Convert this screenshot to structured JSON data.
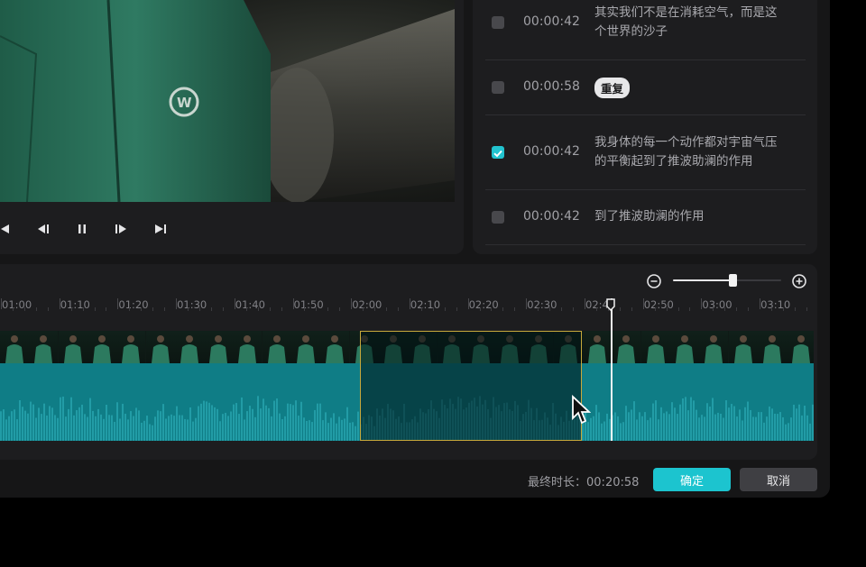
{
  "player": {
    "controls": [
      {
        "name": "skip-back-icon"
      },
      {
        "name": "step-back-icon"
      },
      {
        "name": "pause-icon"
      },
      {
        "name": "step-forward-icon"
      },
      {
        "name": "skip-forward-icon"
      }
    ]
  },
  "transcript": {
    "rows": [
      {
        "checked": false,
        "time": "00:00:42",
        "text": "其实我们不是在消耗空气，而是这个世界的沙子"
      },
      {
        "checked": false,
        "time": "00:00:58",
        "badge": "重复"
      },
      {
        "checked": true,
        "time": "00:00:42",
        "text": "我身体的每一个动作都对宇宙气压的平衡起到了推波助澜的作用"
      },
      {
        "checked": false,
        "time": "00:00:42",
        "text": "到了推波助澜的作用"
      }
    ]
  },
  "timeline": {
    "zoom_level": 0.55,
    "ticks": [
      "01:00",
      "01:10",
      "01:20",
      "01:30",
      "01:40",
      "01:50",
      "02:00",
      "02:10",
      "02:20",
      "02:30",
      "02:40",
      "02:50",
      "03:00",
      "03:10"
    ]
  },
  "footer": {
    "final_duration_label": "最终时长：",
    "final_duration": "00:20:58",
    "confirm_label": "确定",
    "cancel_label": "取消"
  },
  "colors": {
    "accent": "#1cc4cf",
    "selection": "#c7a93b",
    "waveform": "#0f7d86"
  }
}
